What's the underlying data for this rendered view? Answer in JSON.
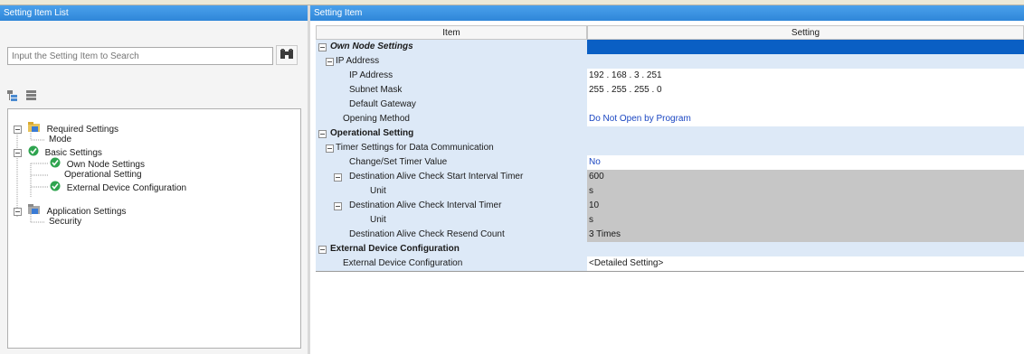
{
  "left_pane": {
    "title": "Setting Item List",
    "search_placeholder": "Input the Setting Item to Search",
    "tree": [
      {
        "label": "Required Settings",
        "icon": "folder-icon"
      },
      {
        "label": "Mode",
        "icon": ""
      },
      {
        "label": "Basic Settings",
        "icon": "green-check-icon"
      },
      {
        "label": "Own Node Settings",
        "icon": "green-check-icon"
      },
      {
        "label": "Operational Setting",
        "icon": ""
      },
      {
        "label": "External Device Configuration",
        "icon": "green-check-icon"
      },
      {
        "label": "Application Settings",
        "icon": "app-settings-icon"
      },
      {
        "label": "Security",
        "icon": ""
      }
    ]
  },
  "right_pane": {
    "title": "Setting Item",
    "columns": {
      "item": "Item",
      "setting": "Setting"
    },
    "rows": [
      {
        "item": "Own Node Settings",
        "setting": ""
      },
      {
        "item": "IP Address",
        "setting": ""
      },
      {
        "item": "IP Address",
        "setting": "192 . 168 .  3 . 251"
      },
      {
        "item": "Subnet Mask",
        "setting": "255 . 255 . 255 .  0"
      },
      {
        "item": "Default Gateway",
        "setting": ""
      },
      {
        "item": "Opening Method",
        "setting": "Do Not Open by Program"
      },
      {
        "item": "Operational Setting",
        "setting": ""
      },
      {
        "item": "Timer Settings for Data Communication",
        "setting": ""
      },
      {
        "item": "Change/Set Timer Value",
        "setting": "No"
      },
      {
        "item": "Destination Alive Check Start Interval Timer",
        "setting": "600"
      },
      {
        "item": "Unit",
        "setting": "s"
      },
      {
        "item": "Destination Alive Check Interval Timer",
        "setting": "10"
      },
      {
        "item": "Unit",
        "setting": "s"
      },
      {
        "item": "Destination Alive Check Resend Count",
        "setting": "3 Times"
      },
      {
        "item": "External Device Configuration",
        "setting": ""
      },
      {
        "item": "External Device Configuration",
        "setting": "<Detailed Setting>"
      }
    ]
  },
  "colors": {
    "header_blue": "#2f86d8",
    "selected_blue": "#0a5fc4",
    "row_blue": "#dde9f7",
    "disabled_gray": "#c6c6c6",
    "link_blue": "#1a46c2"
  }
}
